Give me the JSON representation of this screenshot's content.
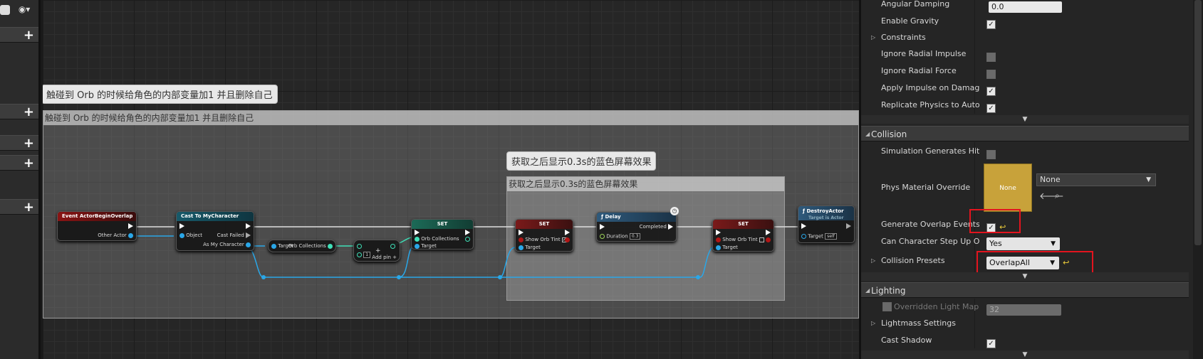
{
  "left_panel": {
    "eye_label": "◉▾"
  },
  "graph": {
    "comment1": {
      "bubble": "触碰到 Orb 的时候给角色的内部变量加1 并且删除自己",
      "title": "触碰到 Orb 的时候给角色的内部变量加1 并且删除自己"
    },
    "comment2": {
      "bubble": "获取之后显示0.3s的蓝色屏幕效果",
      "title": "获取之后显示0.3s的蓝色屏幕效果"
    },
    "nodes": {
      "event": {
        "title": "Event ActorBeginOverlap",
        "pin_other": "Other Actor"
      },
      "cast": {
        "title": "Cast To MyCharacter",
        "pin_object": "Object",
        "pin_failed": "Cast Failed",
        "pin_as": "As My Character"
      },
      "get": {
        "pin_target": "Target",
        "pin_orb": "Orb Collections"
      },
      "add": {
        "value": "1",
        "label": "Add pin"
      },
      "set1": {
        "title": "SET",
        "pin_orb": "Orb Collections",
        "pin_target": "Target"
      },
      "set2": {
        "title": "SET",
        "pin_tint": "Show Orb Tint",
        "pin_target": "Target"
      },
      "delay": {
        "title": "Delay",
        "pin_completed": "Completed",
        "pin_duration": "Duration",
        "duration_value": "0.3"
      },
      "set3": {
        "title": "SET",
        "pin_tint": "Show Orb Tint",
        "pin_target": "Target"
      },
      "destroy": {
        "title": "DestroyActor",
        "subtitle": "Target is Actor",
        "pin_target": "Target",
        "target_value": "self"
      }
    }
  },
  "details": {
    "rows_top": [
      {
        "label": "Angular Damping",
        "value": "0.0"
      },
      {
        "label": "Enable Gravity"
      },
      {
        "label": "Constraints"
      },
      {
        "label": "Ignore Radial Impulse"
      },
      {
        "label": "Ignore Radial Force"
      },
      {
        "label": "Apply Impulse on Damage"
      },
      {
        "label": "Replicate Physics to Autonom"
      }
    ],
    "collision": {
      "header": "Collision",
      "sim_hit": "Simulation Generates Hit Eve",
      "phys_material": "Phys Material Override",
      "swatch": "None",
      "phys_combo": "None",
      "gen_overlap": "Generate Overlap Events",
      "step_up": "Can Character Step Up On",
      "step_up_value": "Yes",
      "presets": "Collision Presets",
      "presets_value": "OverlapAll"
    },
    "lighting": {
      "header": "Lighting",
      "light_map": "Overridden Light Map Re",
      "light_map_value": "32",
      "lightmass": "Lightmass Settings",
      "cast_shadow": "Cast Shadow"
    }
  }
}
